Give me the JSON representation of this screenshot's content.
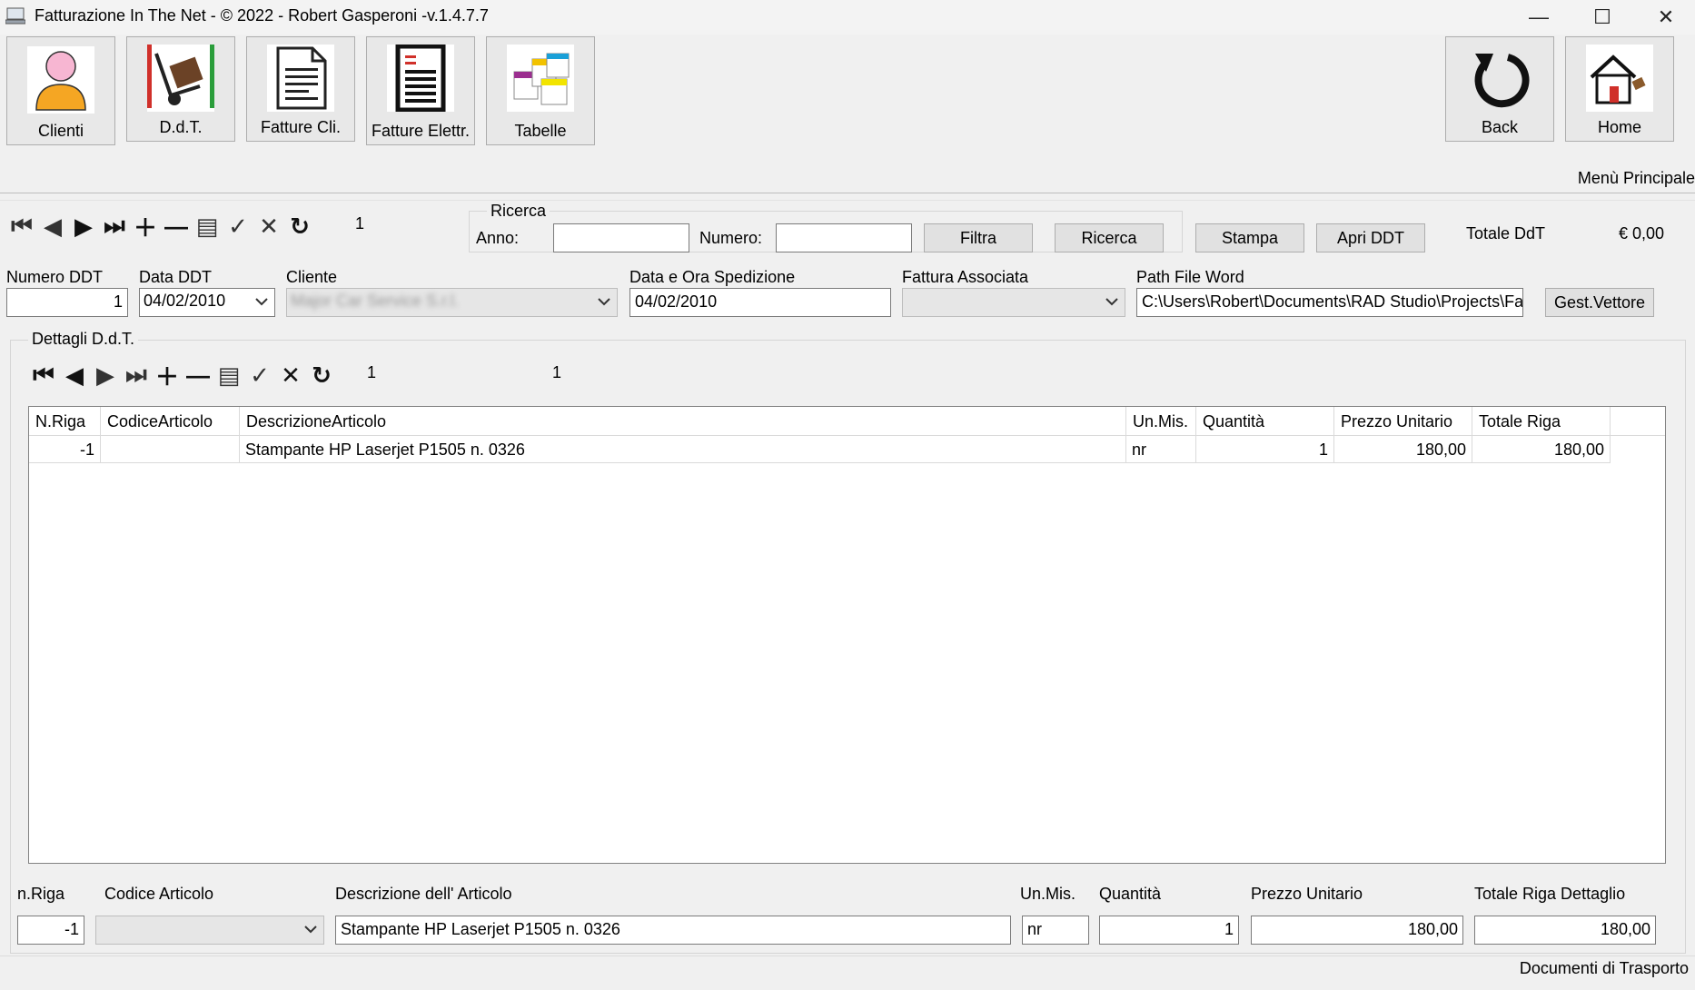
{
  "window": {
    "title": "Fatturazione In The Net - © 2022 - Robert Gasperoni -v.1.4.7.7",
    "minimize": "—",
    "maximize": "☐",
    "close": "✕"
  },
  "toolbar": {
    "clienti": "Clienti",
    "ddt": "D.d.T.",
    "fatture_cli": "Fatture Cli.",
    "fatture_elettr": "Fatture Elettr.",
    "tabelle": "Tabelle",
    "back": "Back",
    "home": "Home"
  },
  "menu_label": "Menù Principale",
  "nav_top": {
    "position": "1"
  },
  "search": {
    "group_title": "Ricerca",
    "anno_label": "Anno:",
    "anno_value": "",
    "numero_label": "Numero:",
    "numero_value": "",
    "filtra": "Filtra",
    "ricerca": "Ricerca"
  },
  "actions": {
    "stampa": "Stampa",
    "apri_ddt": "Apri DDT"
  },
  "totale": {
    "label": "Totale DdT",
    "value": "€ 0,00"
  },
  "header_fields": {
    "numero_ddt_label": "Numero DDT",
    "numero_ddt_value": "1",
    "data_ddt_label": "Data DDT",
    "data_ddt_value": "04/02/2010",
    "cliente_label": "Cliente",
    "cliente_value": "Major Car Service S.r.l.",
    "data_spedizione_label": "Data e Ora Spedizione",
    "data_spedizione_value": "04/02/2010",
    "fattura_label": "Fattura Associata",
    "fattura_value": "",
    "path_label": "Path File Word",
    "path_value": "C:\\Users\\Robert\\Documents\\RAD Studio\\Projects\\Fat",
    "gest_vettore": "Gest.Vettore"
  },
  "details": {
    "group_title": "Dettagli D.d.T.",
    "nav_position": "1",
    "nav_count": "1",
    "columns": [
      "N.Riga",
      "CodiceArticolo",
      "DescrizioneArticolo",
      "Un.Mis.",
      "Quantità",
      "Prezzo Unitario",
      "Totale Riga"
    ],
    "rows": [
      [
        "-1",
        "",
        "Stampante HP Laserjet P1505 n. 0326",
        "nr",
        "1",
        "180,00",
        "180,00"
      ]
    ]
  },
  "edit": {
    "nriga_label": "n.Riga",
    "nriga_value": "-1",
    "codice_label": "Codice Articolo",
    "codice_value": "",
    "descrizione_label": "Descrizione dell' Articolo",
    "descrizione_value": "Stampante HP Laserjet P1505 n. 0326",
    "unmis_label": "Un.Mis.",
    "unmis_value": "nr",
    "quantita_label": "Quantità",
    "quantita_value": "1",
    "prezzo_label": "Prezzo Unitario",
    "prezzo_value": "180,00",
    "totale_label": "Totale Riga Dettaglio",
    "totale_value": "180,00"
  },
  "status": "Documenti di Trasporto"
}
